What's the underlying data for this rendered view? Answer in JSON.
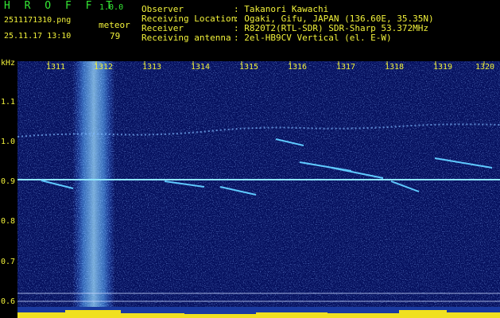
{
  "app": {
    "title": "H R O F F T",
    "version": "1.0.0"
  },
  "file": {
    "name": "2511171310.png",
    "timestamp": "25.11.17 13:10"
  },
  "counter": {
    "label": "meteor",
    "value": "79"
  },
  "info": {
    "rows": [
      {
        "label": "Observer",
        "value": ": Takanori Kawachi"
      },
      {
        "label": "Receiving Location",
        "value": ": Ogaki, Gifu, JAPAN (136.60E, 35.35N)"
      },
      {
        "label": "Receiver",
        "value": ": R820T2(RTL-SDR) SDR-Sharp 53.372MHz"
      },
      {
        "label": "Receiving antenna",
        "value": ": 2el-HB9CV Vertical (el. E-W)"
      }
    ]
  },
  "axis": {
    "unit": "kHz",
    "freq_ticks": [
      "1.1",
      "1.0",
      "0.9",
      "0.8",
      "0.7",
      "0.6"
    ],
    "time_ticks": [
      "1311",
      "1312",
      "1313",
      "1314",
      "1315",
      "1316",
      "1317",
      "1318",
      "1319",
      "1320"
    ]
  },
  "colors": {
    "background": "#06115f",
    "signal": "#5fc9ff",
    "text_green": "#35e835",
    "text_yellow": "#f2f23a"
  }
}
